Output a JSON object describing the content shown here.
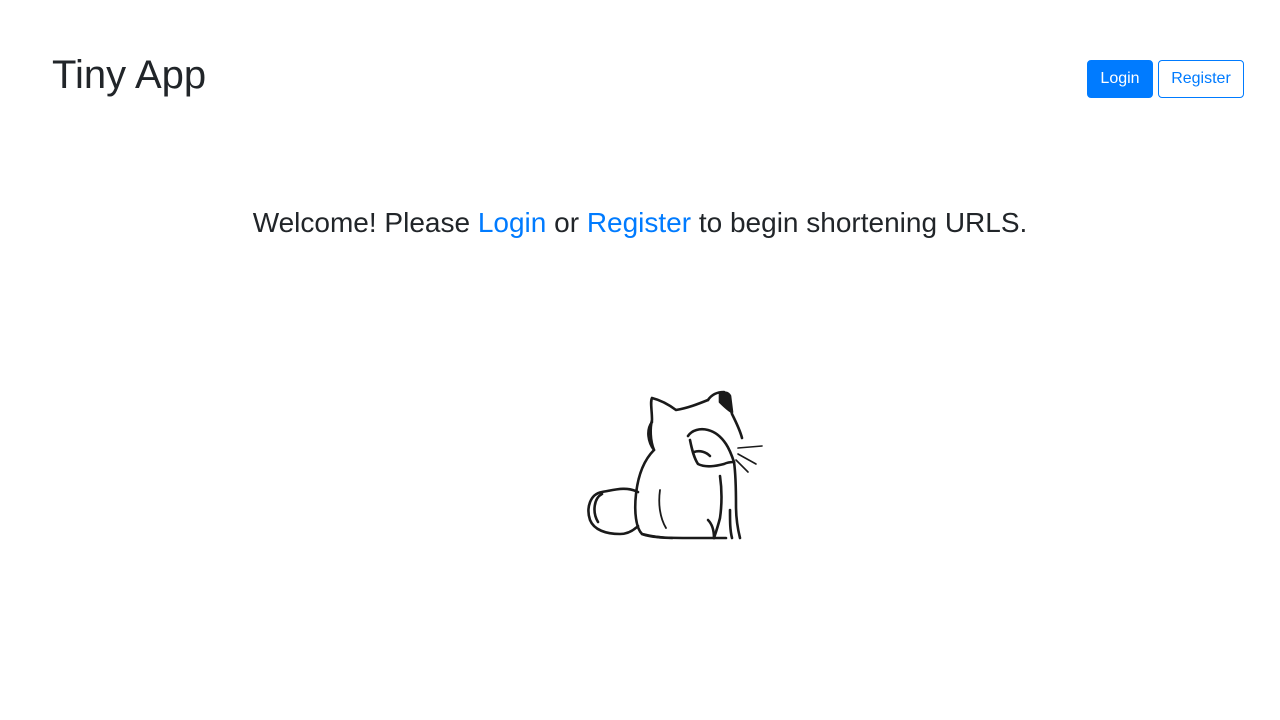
{
  "header": {
    "brand": "Tiny App",
    "login_label": "Login",
    "register_label": "Register"
  },
  "main": {
    "welcome_prefix": "Welcome! Please ",
    "login_link": "Login",
    "or_text": " or ",
    "register_link": "Register",
    "welcome_suffix": " to begin shortening URLS."
  },
  "colors": {
    "accent": "#007bff",
    "text": "#212529",
    "background": "#ffffff"
  }
}
